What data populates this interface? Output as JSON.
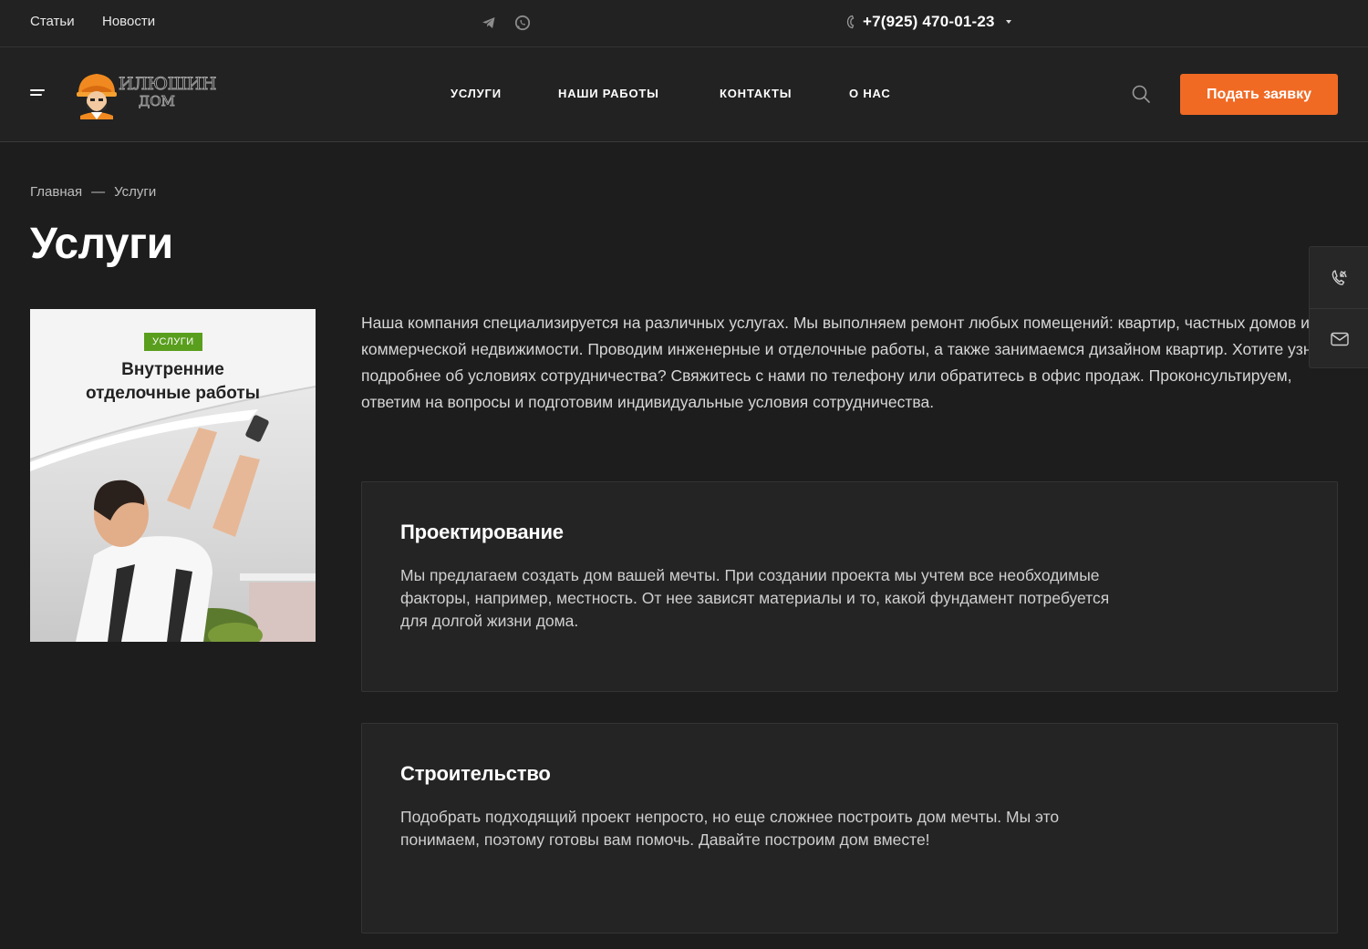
{
  "topbar": {
    "links": [
      "Статьи",
      "Новости"
    ],
    "social_icons": [
      "telegram-icon",
      "whatsapp-icon"
    ],
    "phone": "+7(925) 470-01-23"
  },
  "header": {
    "logo": {
      "line1": "ИЛЮШИН",
      "line2": "ДОМ"
    },
    "nav": [
      "УСЛУГИ",
      "НАШИ РАБОТЫ",
      "КОНТАКТЫ",
      "О НАС"
    ],
    "cta_label": "Подать заявку",
    "accent_color": "#f06a24"
  },
  "breadcrumb": {
    "home": "Главная",
    "separator": "—",
    "current": "Услуги"
  },
  "page_title": "Услуги",
  "banner": {
    "badge": "УСЛУГИ",
    "title_line1": "Внутренние",
    "title_line2": "отделочные работы",
    "badge_color": "#5a9e1e"
  },
  "intro": "Наша компания специализируется на различных услугах. Мы выполняем ремонт любых помещений: квартир, частных домов и коммерческой недвижимости. Проводим инженерные и отделочные работы, а также занимаемся дизайном квартир. Хотите узнать подробнее об условиях сотрудничества? Свяжитесь с нами по телефону или обратитесь в офис продаж. Проконсультируем, ответим на вопросы и подготовим индивидуальные условия сотрудничества.",
  "services": [
    {
      "title": "Проектирование",
      "text": "Мы предлагаем создать дом вашей мечты. При создании проекта мы учтем все необходимые факторы, например, местность. От нее зависят материалы и то, какой фундамент потребуется для долгой жизни дома."
    },
    {
      "title": "Строительство",
      "text": "Подобрать подходящий проект непросто, но еще сложнее построить дом мечты. Мы это понимаем, поэтому готовы вам помочь. Давайте построим дом вместе!"
    }
  ],
  "side_panel": [
    "callback-icon",
    "mail-icon"
  ]
}
